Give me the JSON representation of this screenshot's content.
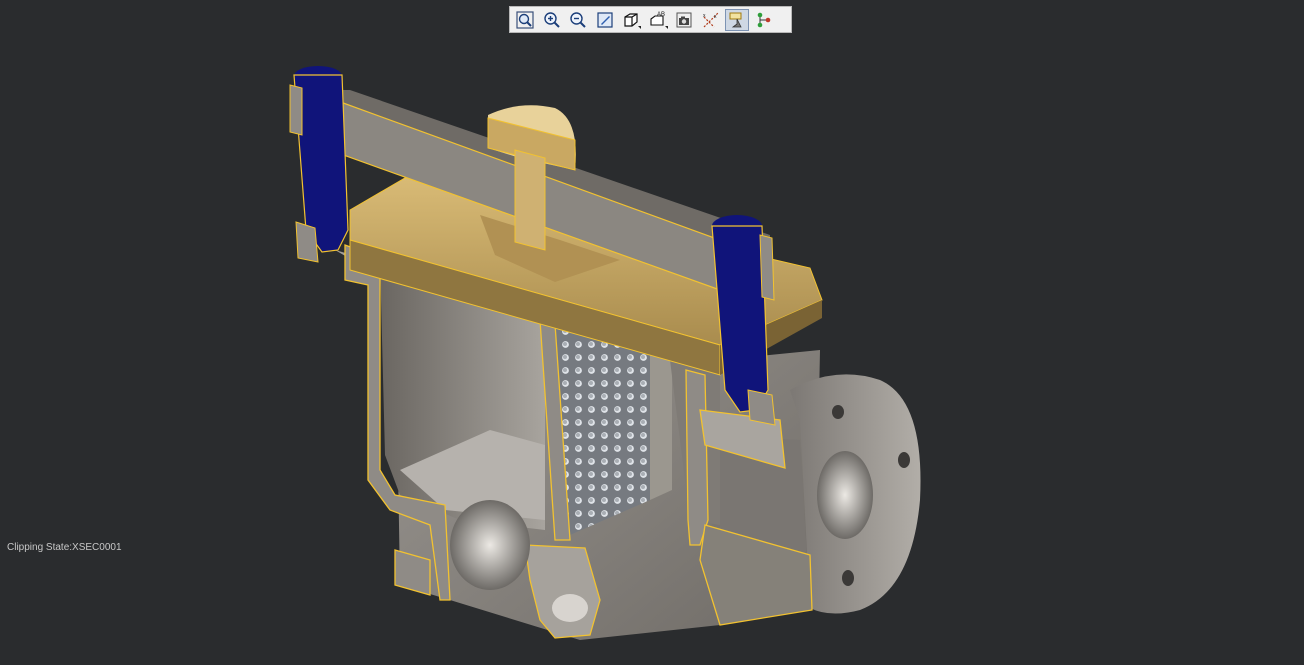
{
  "toolbar": {
    "buttons": [
      {
        "name": "zoom-fit-button",
        "icon": "zoom-fit-icon",
        "active": false,
        "dropdown": false
      },
      {
        "name": "zoom-in-button",
        "icon": "zoom-in-icon",
        "active": false,
        "dropdown": false
      },
      {
        "name": "zoom-out-button",
        "icon": "zoom-out-icon",
        "active": false,
        "dropdown": false
      },
      {
        "name": "repaint-button",
        "icon": "repaint-icon",
        "active": false,
        "dropdown": false
      },
      {
        "name": "display-style-button",
        "icon": "cube-icon",
        "active": false,
        "dropdown": true
      },
      {
        "name": "saved-views-button",
        "icon": "saved-views-icon",
        "active": false,
        "dropdown": true
      },
      {
        "name": "snapshot-button",
        "icon": "camera-icon",
        "active": false,
        "dropdown": false
      },
      {
        "name": "datum-display-button",
        "icon": "datum-axes-icon",
        "active": false,
        "dropdown": false
      },
      {
        "name": "clipping-button",
        "icon": "section-plane-icon",
        "active": true,
        "dropdown": false
      },
      {
        "name": "model-tree-button",
        "icon": "tree-nodes-icon",
        "active": false,
        "dropdown": false
      }
    ],
    "colors": {
      "background": "#f0f0f0",
      "active": "#cfd8e4"
    }
  },
  "status": {
    "clipping_state": "Clipping State:XSEC0001"
  },
  "model": {
    "description_icon": "strainer-cross-section",
    "colors": {
      "body": "#8e8a85",
      "body_dark": "#5e5b57",
      "cover": "#c9a862",
      "cover_light": "#e8d29a",
      "bolt": "#10147a",
      "screen": "#7d8186",
      "section_edge": "#f2c230",
      "background": "#2a2c2e"
    }
  }
}
